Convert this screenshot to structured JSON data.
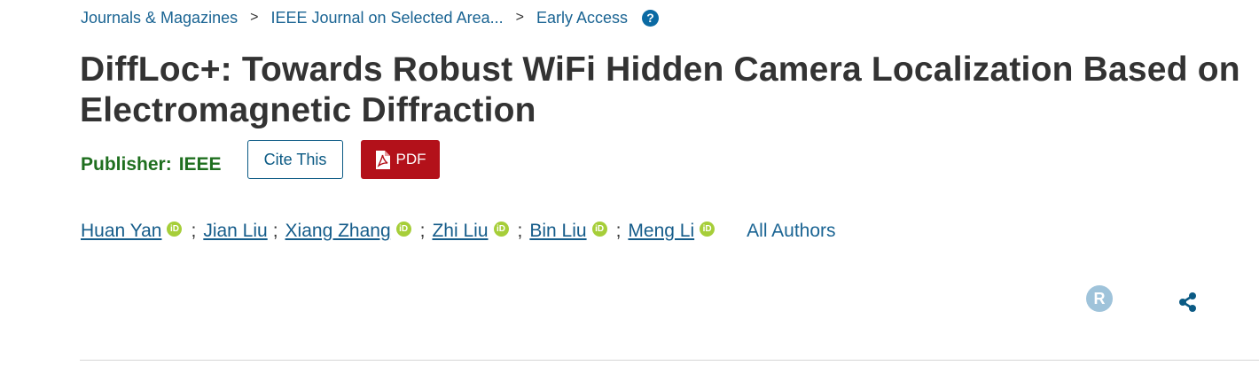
{
  "breadcrumb": {
    "items": [
      "Journals & Magazines",
      "IEEE Journal on Selected Area...",
      "Early Access"
    ],
    "separator": ">",
    "help_icon": "question-circle-icon"
  },
  "article": {
    "title": "DiffLoc+: Towards Robust WiFi Hidden Camera Localization Based on Electromagnetic Diffraction"
  },
  "publisher": {
    "label": "Publisher:",
    "name": "IEEE"
  },
  "actions": {
    "cite_label": "Cite This",
    "pdf_label": "PDF",
    "pdf_icon": "pdf-file-icon"
  },
  "authors": {
    "list": [
      {
        "name": "Huan Yan",
        "orcid": true
      },
      {
        "name": "Jian Liu",
        "orcid": false
      },
      {
        "name": "Xiang Zhang",
        "orcid": true
      },
      {
        "name": "Zhi Liu",
        "orcid": true
      },
      {
        "name": "Bin Liu",
        "orcid": true
      },
      {
        "name": "Meng Li",
        "orcid": true
      }
    ],
    "separator": ";",
    "orcid_badge_text": "iD",
    "all_authors_label": "All Authors"
  },
  "tools": {
    "r_icon_text": "R",
    "share_icon": "share-icon"
  },
  "colors": {
    "link": "#1a6493",
    "publisher": "#1f6f1f",
    "pdf_button": "#b3111a",
    "orcid": "#a6ce39"
  }
}
